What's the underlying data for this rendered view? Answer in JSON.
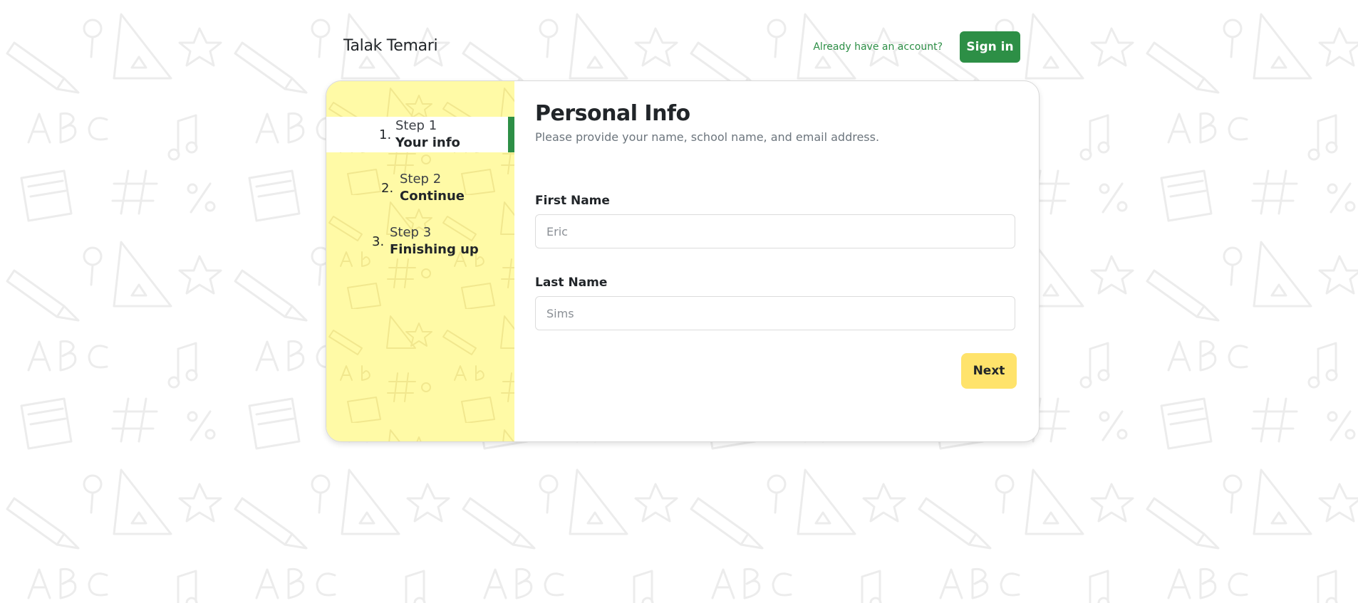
{
  "header": {
    "brand": "Talak Temari",
    "already_link": "Already have an account?",
    "signin_label": "Sign in"
  },
  "steps": [
    {
      "number": "1.",
      "label": "Step 1",
      "title": "Your info",
      "active": true
    },
    {
      "number": "2.",
      "label": "Step 2",
      "title": "Continue",
      "active": false
    },
    {
      "number": "3.",
      "label": "Step 3",
      "title": "Finishing up",
      "active": false
    }
  ],
  "form": {
    "title": "Personal Info",
    "subtitle": "Please provide your name, school name, and email address.",
    "first_name": {
      "label": "First Name",
      "placeholder": "Eric",
      "value": ""
    },
    "last_name": {
      "label": "Last Name",
      "placeholder": "Sims",
      "value": ""
    },
    "next_label": "Next"
  },
  "colors": {
    "accent_green": "#2d8f46",
    "sidebar_yellow": "#fffaa6",
    "next_yellow": "#ffe36b"
  }
}
